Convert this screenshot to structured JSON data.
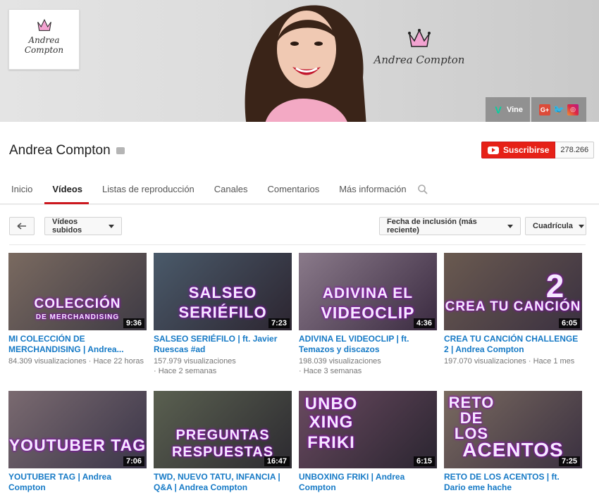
{
  "channel": {
    "avatar_text": "Andrea Compton",
    "banner_brand": "Andrea Compton",
    "name": "Andrea Compton",
    "subscribe_label": "Suscribirse",
    "subscriber_count": "278.266",
    "social": {
      "vine": "Vine",
      "gplus": "G+"
    }
  },
  "tabs": [
    "Inicio",
    "Vídeos",
    "Listas de reproducción",
    "Canales",
    "Comentarios",
    "Más información"
  ],
  "toolbar": {
    "filter": "Vídeos subidos",
    "sort": "Fecha de inclusión (más reciente)",
    "view": "Cuadrícula"
  },
  "videos": [
    {
      "title": "MI COLECCIÓN DE MERCHANDISING | Andrea...",
      "views": "84.309 visualizaciones",
      "ago": "Hace 22 horas",
      "duration": "9:36",
      "thumb_text": "COLECCIÓN",
      "thumb_sub": "DE MERCHANDISING"
    },
    {
      "title": "SALSEO SERIÉFILO | ft. Javier Ruescas #ad",
      "views": "157.979 visualizaciones",
      "ago": "Hace 2 semanas",
      "duration": "7:23",
      "thumb_text": "SALSEO",
      "thumb_sub": "SERIÉFILO"
    },
    {
      "title": "ADIVINA EL VIDEOCLIP | ft. Temazos y discazos",
      "views": "198.039 visualizaciones",
      "ago": "Hace 3 semanas",
      "duration": "4:36",
      "thumb_text": "ADIVINA EL",
      "thumb_sub": "VIDEOCLIP"
    },
    {
      "title": "CREA TU CANCIÓN CHALLENGE 2 | Andrea Compton",
      "views": "197.070 visualizaciones",
      "ago": "Hace 1 mes",
      "duration": "6:05",
      "thumb_text": "CREA TU CANCIÓN",
      "thumb_sub": "2"
    },
    {
      "title": "YOUTUBER TAG | Andrea Compton",
      "views": "",
      "ago": "",
      "duration": "7:06",
      "thumb_text": "YOUTUBER TAG",
      "thumb_sub": ""
    },
    {
      "title": "TWD, NUEVO TATU, INFANCIA | Q&A | Andrea Compton",
      "views": "",
      "ago": "",
      "duration": "16:47",
      "thumb_text": "PREGUNTAS",
      "thumb_sub": "RESPUESTAS"
    },
    {
      "title": "UNBOXING FRIKI | Andrea Compton",
      "views": "",
      "ago": "",
      "duration": "6:15",
      "thumb_text": "UNBO XING",
      "thumb_sub": "FRIKI"
    },
    {
      "title": "RETO DE LOS ACENTOS | ft. Dario eme hache",
      "views": "",
      "ago": "",
      "duration": "7:25",
      "thumb_text": "RETO DE LOS",
      "thumb_sub": "ACENTOS"
    }
  ],
  "colors": {
    "accent": "#cc181e",
    "link": "#167ac6",
    "subscribe": "#e62117"
  }
}
